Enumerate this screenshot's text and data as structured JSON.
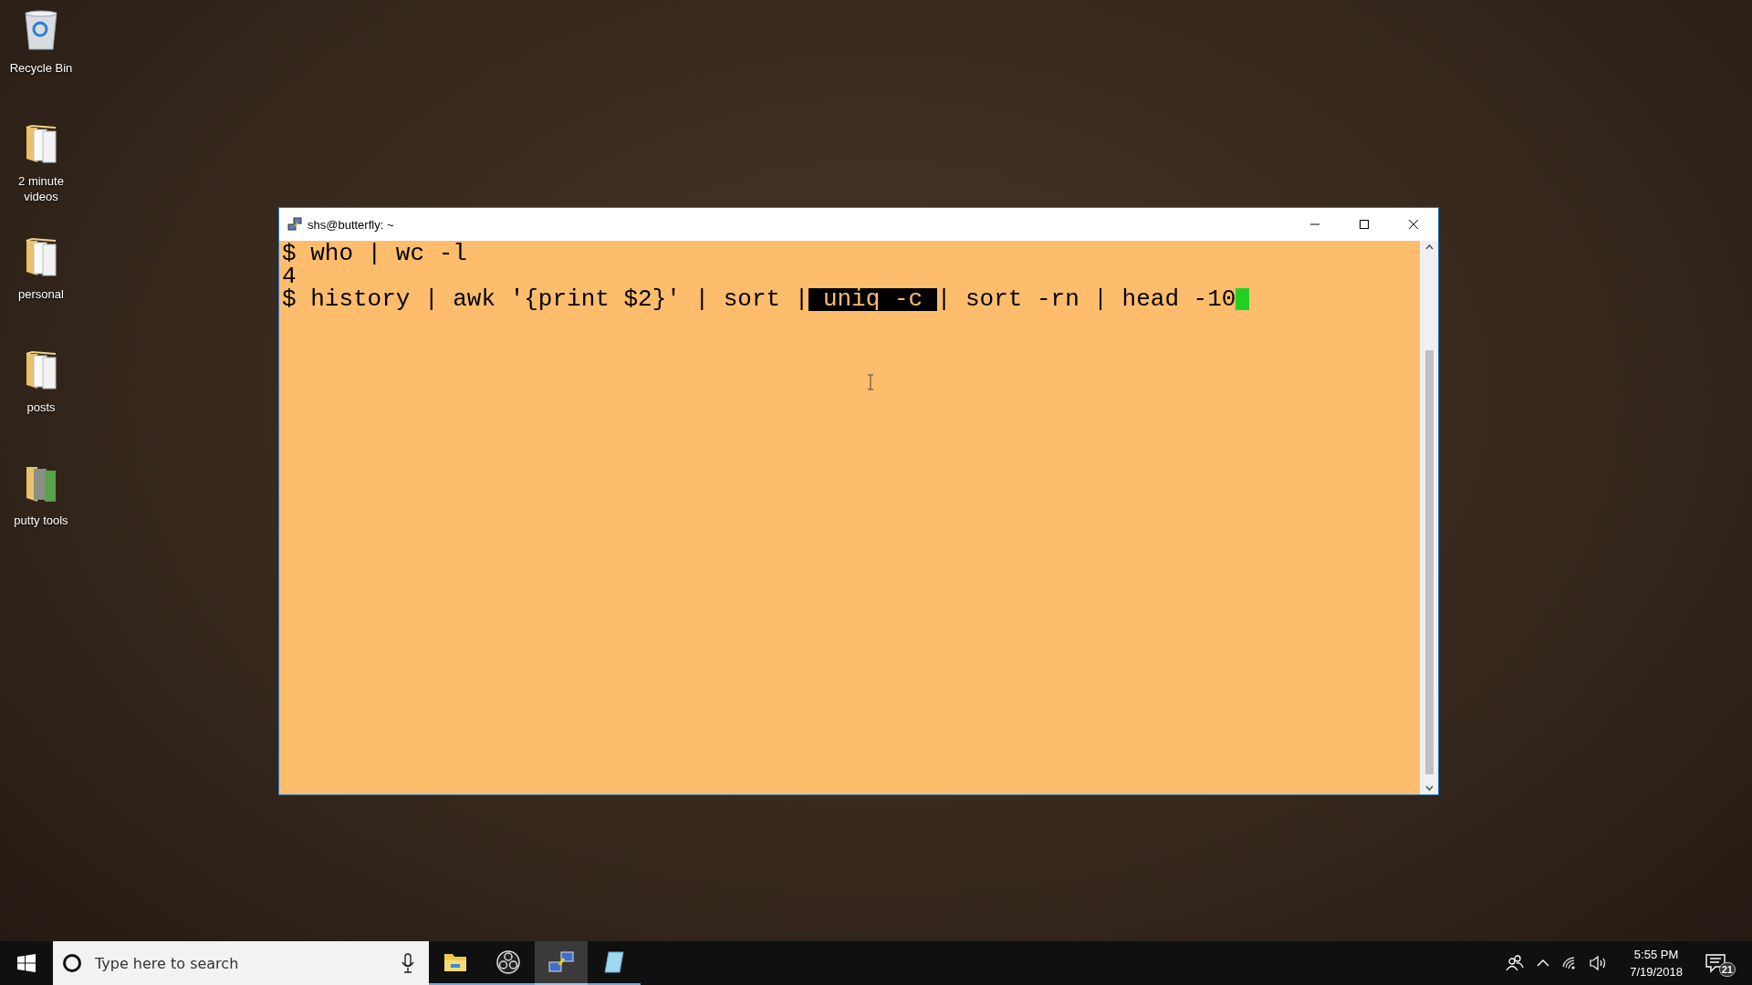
{
  "desktop_icons": [
    {
      "label": "Recycle Bin",
      "kind": "bin"
    },
    {
      "label": "2 minute videos",
      "kind": "folder"
    },
    {
      "label": "personal",
      "kind": "folder"
    },
    {
      "label": "posts",
      "kind": "folder"
    },
    {
      "label": "putty tools",
      "kind": "photo-folder"
    }
  ],
  "window": {
    "title": "shs@butterfly: ~",
    "terminal": {
      "lines": [
        {
          "segments": [
            {
              "text": "$ who | wc -l",
              "highlighted": false
            }
          ],
          "cursor": false
        },
        {
          "segments": [
            {
              "text": "4",
              "highlighted": false
            }
          ],
          "cursor": false
        },
        {
          "segments": [
            {
              "text": "$ history | awk '{print $2}' | sort |",
              "highlighted": false
            },
            {
              "text": " uniq -c ",
              "highlighted": true
            },
            {
              "text": "| sort -rn | head -10",
              "highlighted": false
            }
          ],
          "cursor": true
        }
      ]
    }
  },
  "taskbar": {
    "search": {
      "placeholder": "Type here to search"
    },
    "apps": [
      {
        "kind": "explorer",
        "running": true,
        "selected": false
      },
      {
        "kind": "obs",
        "running": true,
        "selected": false
      },
      {
        "kind": "putty",
        "running": true,
        "selected": true
      },
      {
        "kind": "notepad",
        "running": true,
        "selected": false
      }
    ],
    "clock": {
      "time": "5:55 PM",
      "date": "7/19/2018"
    },
    "notifications": {
      "count": "21"
    }
  }
}
